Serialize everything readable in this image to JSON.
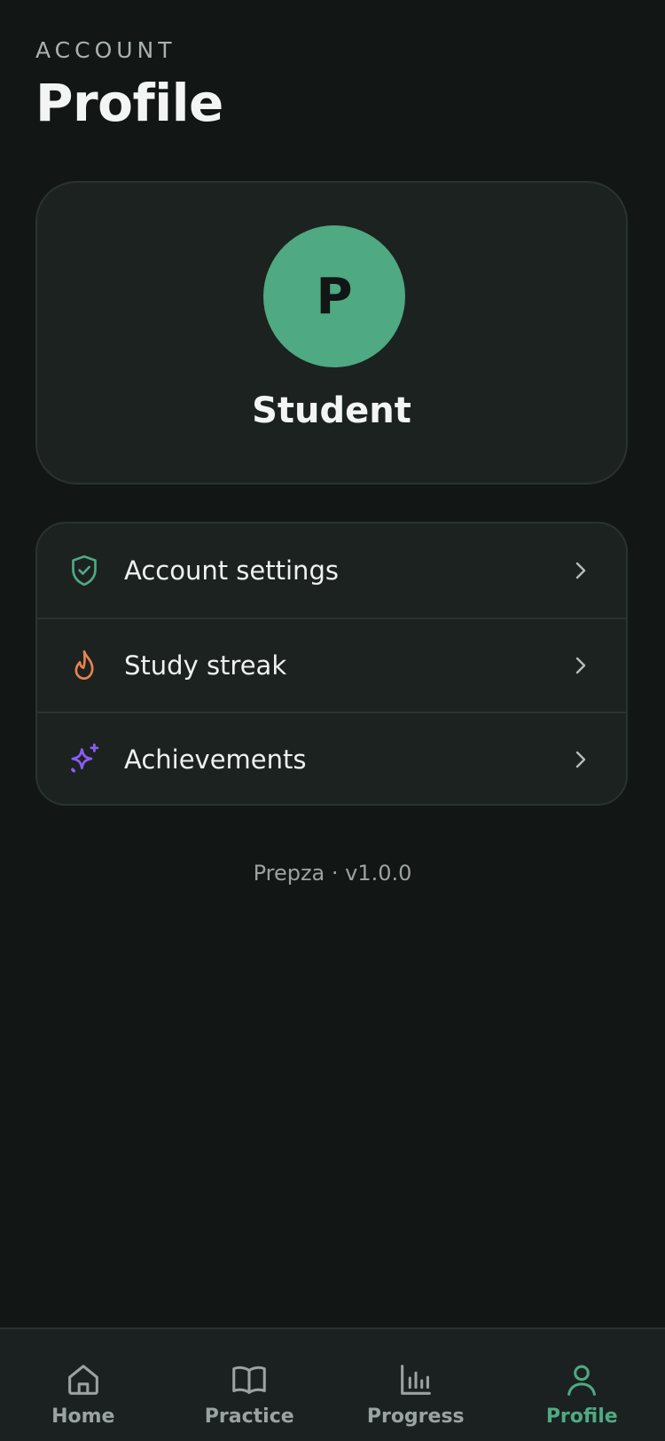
{
  "header": {
    "eyebrow": "ACCOUNT",
    "title": "Profile"
  },
  "profile": {
    "avatar_initial": "P",
    "name": "Student",
    "avatar_color": "#4fa983"
  },
  "menu": {
    "items": [
      {
        "label": "Account settings",
        "icon": "shield-check-icon",
        "icon_color": "#4fa983"
      },
      {
        "label": "Study streak",
        "icon": "flame-icon",
        "icon_color": "#e8834f"
      },
      {
        "label": "Achievements",
        "icon": "sparkles-icon",
        "icon_color": "#8b5cf6"
      }
    ]
  },
  "footer": {
    "version": "Prepza · v1.0.0"
  },
  "tabbar": {
    "tabs": [
      {
        "label": "Home",
        "icon": "home-icon",
        "active": false
      },
      {
        "label": "Practice",
        "icon": "book-icon",
        "active": false
      },
      {
        "label": "Progress",
        "icon": "bar-chart-icon",
        "active": false
      },
      {
        "label": "Profile",
        "icon": "user-icon",
        "active": true
      }
    ],
    "active_color": "#4fa983",
    "inactive_color": "#9aa39f"
  }
}
